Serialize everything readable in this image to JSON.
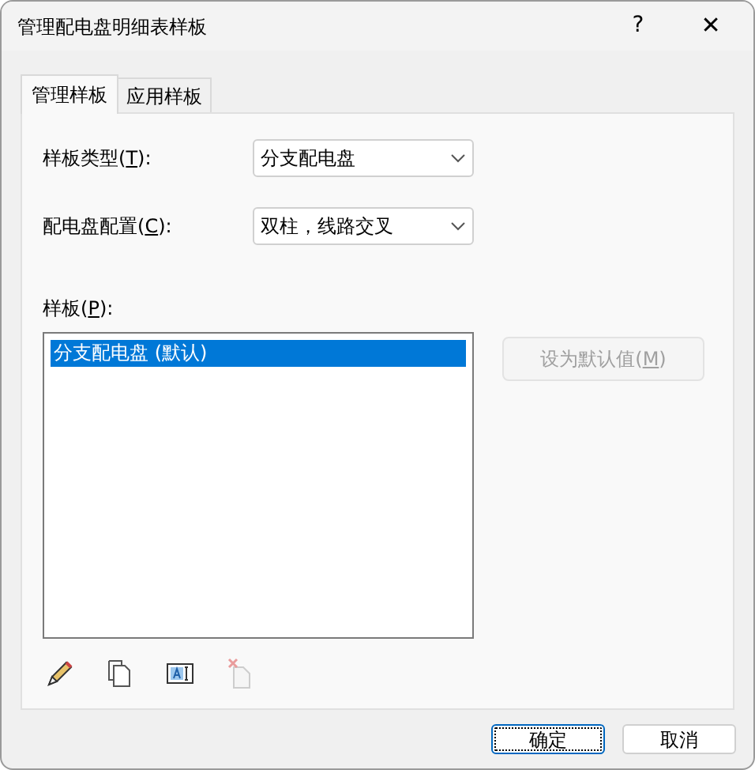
{
  "window": {
    "title": "管理配电盘明细表样板",
    "help": "?",
    "close": "✕"
  },
  "tabs": [
    {
      "label": "管理样板",
      "selected": true
    },
    {
      "label": "应用样板",
      "selected": false
    }
  ],
  "fields": [
    {
      "label": {
        "before": "样板类型(",
        "key": "T",
        "after": "):"
      },
      "value": "分支配电盘"
    },
    {
      "label": {
        "before": "配电盘配置(",
        "key": "C",
        "after": "):"
      },
      "value": "双柱，线路交叉"
    }
  ],
  "templates": {
    "label": {
      "before": "样板(",
      "key": "P",
      "after": "):"
    },
    "items": [
      {
        "text": "分支配电盘 (默认)",
        "selected": true
      }
    ]
  },
  "set_default": {
    "label": {
      "before": "设为默认值(",
      "key": "M",
      "after": ")"
    },
    "disabled": true
  },
  "tools": [
    {
      "kind": "edit",
      "disabled": false
    },
    {
      "kind": "duplicate",
      "disabled": false
    },
    {
      "kind": "rename",
      "disabled": false
    },
    {
      "kind": "delete",
      "disabled": true
    }
  ],
  "buttons": [
    {
      "label": "确定",
      "default": true
    },
    {
      "label": "取消",
      "default": false
    }
  ]
}
